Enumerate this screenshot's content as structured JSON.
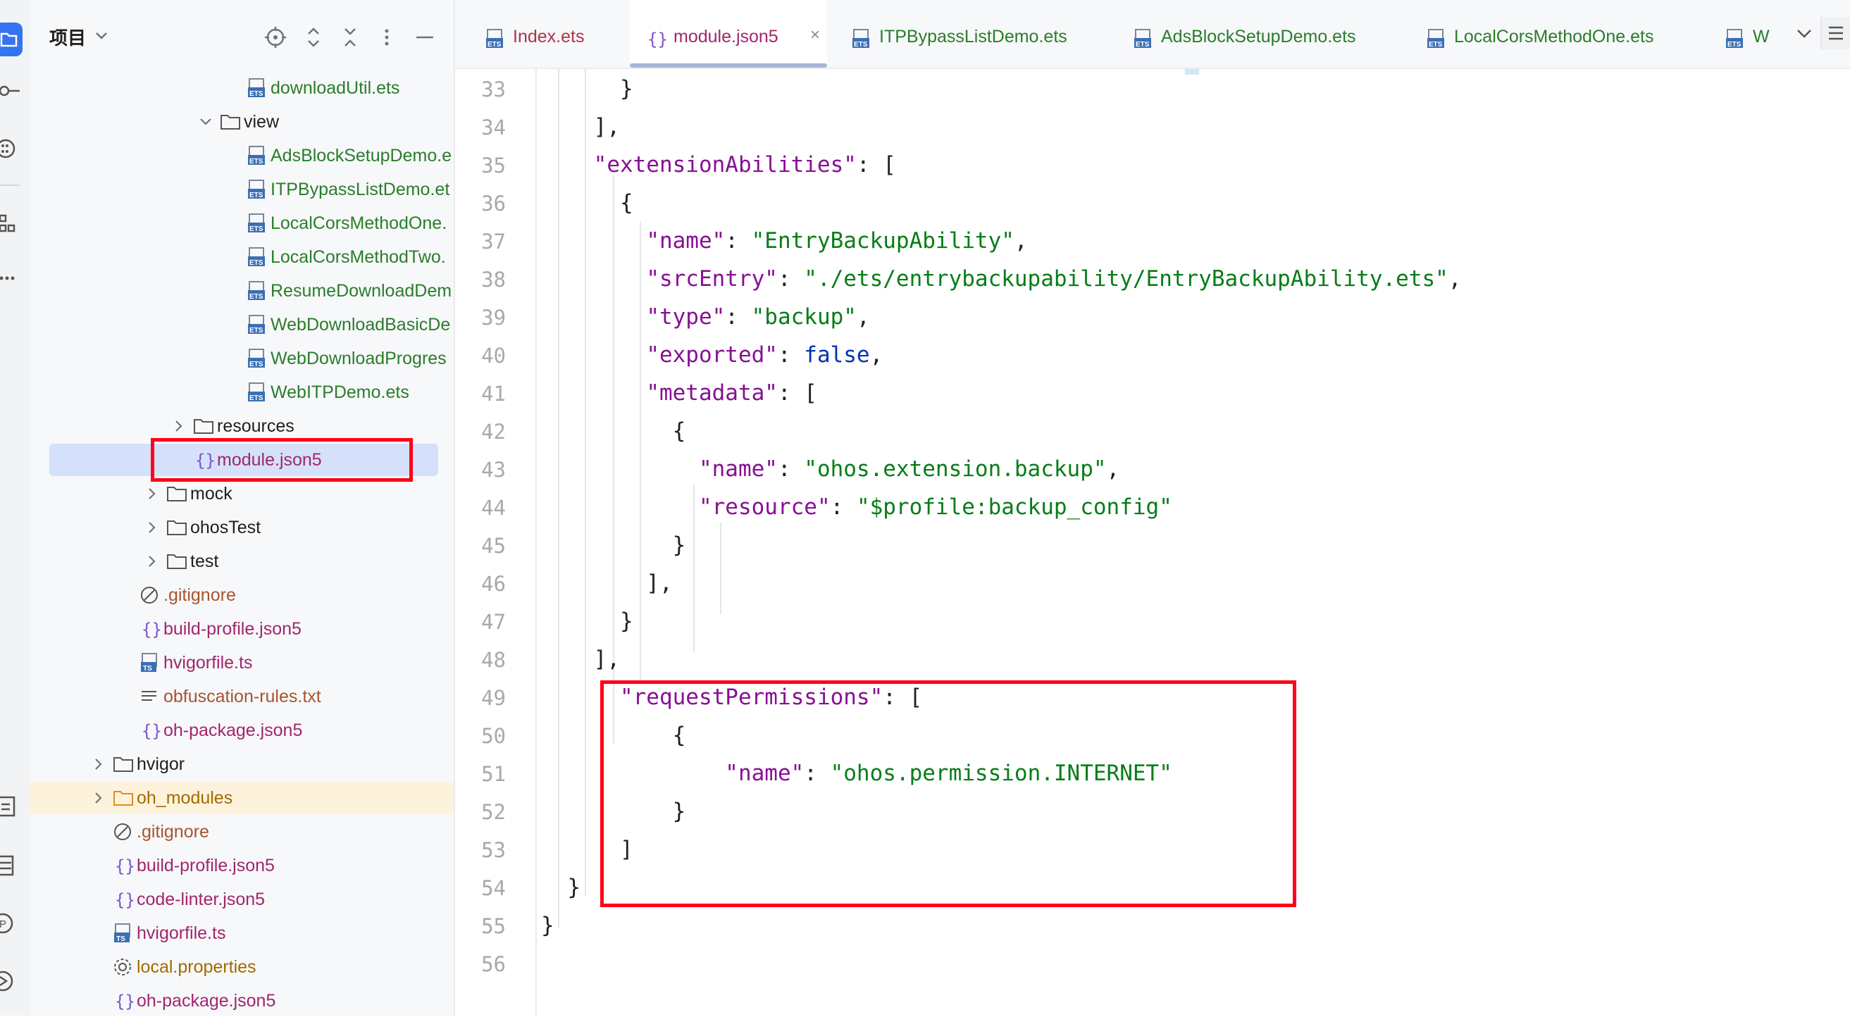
{
  "panel": {
    "title": "项目",
    "tree": [
      {
        "label": "downloadUtil.ets",
        "kind": "ets",
        "indent": 0
      },
      {
        "label": "view",
        "kind": "folder-open",
        "indent": 0
      },
      {
        "label": "AdsBlockSetupDemo.e",
        "kind": "ets",
        "indent": 0
      },
      {
        "label": "ITPBypassListDemo.et",
        "kind": "ets",
        "indent": 0
      },
      {
        "label": "LocalCorsMethodOne.",
        "kind": "ets",
        "indent": 0
      },
      {
        "label": "LocalCorsMethodTwo.",
        "kind": "ets",
        "indent": 0
      },
      {
        "label": "ResumeDownloadDem",
        "kind": "ets",
        "indent": 0
      },
      {
        "label": "WebDownloadBasicDe",
        "kind": "ets",
        "indent": 0
      },
      {
        "label": "WebDownloadProgres",
        "kind": "ets",
        "indent": 0
      },
      {
        "label": "WebITPDemo.ets",
        "kind": "ets",
        "indent": 0
      },
      {
        "label": "resources",
        "kind": "folder",
        "indent": 0
      },
      {
        "label": "module.json5",
        "kind": "json",
        "indent": 0
      },
      {
        "label": "mock",
        "kind": "folder",
        "indent": 0
      },
      {
        "label": "ohosTest",
        "kind": "folder",
        "indent": 0
      },
      {
        "label": "test",
        "kind": "folder",
        "indent": 0
      },
      {
        "label": ".gitignore",
        "kind": "ignore",
        "indent": 0
      },
      {
        "label": "build-profile.json5",
        "kind": "json",
        "indent": 0
      },
      {
        "label": "hvigorfile.ts",
        "kind": "ts",
        "indent": 0
      },
      {
        "label": "obfuscation-rules.txt",
        "kind": "txt",
        "indent": 0
      },
      {
        "label": "oh-package.json5",
        "kind": "json",
        "indent": 0
      },
      {
        "label": "hvigor",
        "kind": "folder",
        "indent": 0
      },
      {
        "label": "oh_modules",
        "kind": "folder-orange",
        "indent": 0
      },
      {
        "label": ".gitignore",
        "kind": "ignore",
        "indent": 0
      },
      {
        "label": "build-profile.json5",
        "kind": "json",
        "indent": 0
      },
      {
        "label": "code-linter.json5",
        "kind": "json",
        "indent": 0
      },
      {
        "label": "hvigorfile.ts",
        "kind": "ts",
        "indent": 0
      },
      {
        "label": "local.properties",
        "kind": "gear",
        "indent": 0
      },
      {
        "label": "oh-package.json5",
        "kind": "json",
        "indent": 0
      }
    ]
  },
  "tabs": [
    {
      "label": "Index.ets",
      "kind": "ets",
      "active": false
    },
    {
      "label": "module.json5",
      "kind": "json",
      "active": true
    },
    {
      "label": "ITPBypassListDemo.ets",
      "kind": "ets",
      "active": false
    },
    {
      "label": "AdsBlockSetupDemo.ets",
      "kind": "ets",
      "active": false
    },
    {
      "label": "LocalCorsMethodOne.ets",
      "kind": "ets",
      "active": false
    },
    {
      "label": "W",
      "kind": "ets",
      "active": false
    }
  ],
  "editor": {
    "lines": [
      {
        "n": "33",
        "t": [
          [
            "p",
            "      }"
          ]
        ]
      },
      {
        "n": "34",
        "t": [
          [
            "p",
            "    ],"
          ]
        ]
      },
      {
        "n": "35",
        "t": [
          [
            "p",
            "    "
          ],
          [
            "k",
            "\"extensionAbilities\""
          ],
          [
            "p",
            ": ["
          ]
        ]
      },
      {
        "n": "36",
        "t": [
          [
            "p",
            "      {"
          ]
        ]
      },
      {
        "n": "37",
        "t": [
          [
            "p",
            "        "
          ],
          [
            "k",
            "\"name\""
          ],
          [
            "p",
            ": "
          ],
          [
            "s",
            "\"EntryBackupAbility\""
          ],
          [
            "p",
            ","
          ]
        ]
      },
      {
        "n": "38",
        "t": [
          [
            "p",
            "        "
          ],
          [
            "k",
            "\"srcEntry\""
          ],
          [
            "p",
            ": "
          ],
          [
            "s",
            "\"./ets/entrybackupability/EntryBackupAbility.ets\""
          ],
          [
            "p",
            ","
          ]
        ]
      },
      {
        "n": "39",
        "t": [
          [
            "p",
            "        "
          ],
          [
            "k",
            "\"type\""
          ],
          [
            "p",
            ": "
          ],
          [
            "s",
            "\"backup\""
          ],
          [
            "p",
            ","
          ]
        ]
      },
      {
        "n": "40",
        "t": [
          [
            "p",
            "        "
          ],
          [
            "k",
            "\"exported\""
          ],
          [
            "p",
            ": "
          ],
          [
            "b",
            "false"
          ],
          [
            "p",
            ","
          ]
        ]
      },
      {
        "n": "41",
        "t": [
          [
            "p",
            "        "
          ],
          [
            "k",
            "\"metadata\""
          ],
          [
            "p",
            ": ["
          ]
        ]
      },
      {
        "n": "42",
        "t": [
          [
            "p",
            "          {"
          ]
        ]
      },
      {
        "n": "43",
        "t": [
          [
            "p",
            "            "
          ],
          [
            "k",
            "\"name\""
          ],
          [
            "p",
            ": "
          ],
          [
            "s",
            "\"ohos.extension.backup\""
          ],
          [
            "p",
            ","
          ]
        ]
      },
      {
        "n": "44",
        "t": [
          [
            "p",
            "            "
          ],
          [
            "k",
            "\"resource\""
          ],
          [
            "p",
            ": "
          ],
          [
            "s",
            "\"$profile:backup_config\""
          ]
        ]
      },
      {
        "n": "45",
        "t": [
          [
            "p",
            "          }"
          ]
        ]
      },
      {
        "n": "46",
        "t": [
          [
            "p",
            "        ],"
          ]
        ]
      },
      {
        "n": "47",
        "t": [
          [
            "p",
            "      }"
          ]
        ]
      },
      {
        "n": "48",
        "t": [
          [
            "p",
            "    ],"
          ]
        ]
      },
      {
        "n": "49",
        "t": [
          [
            "p",
            "      "
          ],
          [
            "k",
            "\"requestPermissions\""
          ],
          [
            "p",
            ": ["
          ]
        ]
      },
      {
        "n": "50",
        "t": [
          [
            "p",
            "          {"
          ]
        ]
      },
      {
        "n": "51",
        "t": [
          [
            "p",
            "              "
          ],
          [
            "k",
            "\"name\""
          ],
          [
            "p",
            ": "
          ],
          [
            "s",
            "\"ohos.permission.INTERNET\""
          ]
        ]
      },
      {
        "n": "52",
        "t": [
          [
            "p",
            "          }"
          ]
        ]
      },
      {
        "n": "53",
        "t": [
          [
            "p",
            "      ]"
          ]
        ]
      },
      {
        "n": "54",
        "t": [
          [
            "p",
            "  }"
          ]
        ]
      },
      {
        "n": "55",
        "t": [
          [
            "p",
            "}"
          ]
        ]
      },
      {
        "n": "56",
        "t": [
          [
            "p",
            ""
          ]
        ]
      }
    ]
  }
}
